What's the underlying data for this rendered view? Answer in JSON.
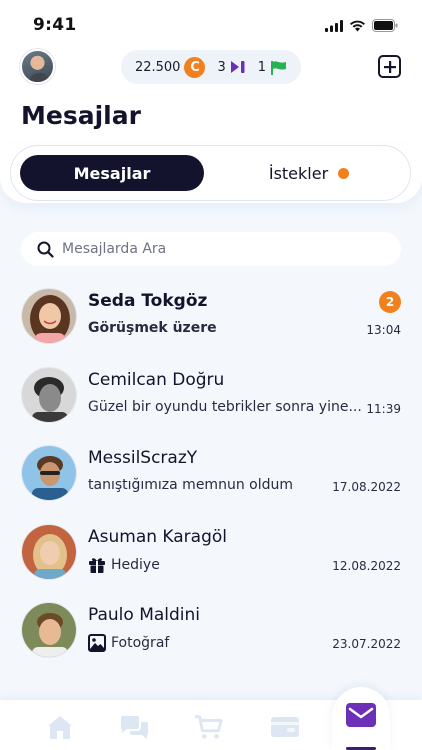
{
  "status_bar": {
    "time": "9:41",
    "icons": [
      "signal-icon",
      "wifi-icon",
      "battery-icon"
    ]
  },
  "header": {
    "coins": "22.500",
    "coin_symbol": "C",
    "games": "3",
    "flags": "1"
  },
  "page_title": "Mesajlar",
  "tabs": [
    {
      "label": "Mesajlar",
      "active": true
    },
    {
      "label": "İstekler",
      "active": false,
      "has_dot": true
    }
  ],
  "search": {
    "placeholder": "Mesajlarda Ara"
  },
  "conversations": [
    {
      "name": "Seda Tokgöz",
      "message": "Görüşmek üzere",
      "time": "13:04",
      "unread": "2",
      "bold": true
    },
    {
      "name": "Cemilcan Doğru",
      "message": "Güzel bir oyundu tebrikler sonra yine...",
      "time": "11:39"
    },
    {
      "name": "MessilScrazY",
      "message": "tanıştığımıza memnun oldum",
      "time": "17.08.2022"
    },
    {
      "name": "Asuman Karagöl",
      "message": "Hediye",
      "time": "12.08.2022",
      "icon": "gift-icon"
    },
    {
      "name": "Paulo Maldini",
      "message": "Fotoğraf",
      "time": "23.07.2022",
      "icon": "image-icon"
    }
  ],
  "bottom_nav": [
    "home-icon",
    "chat-icon",
    "cart-icon",
    "wallet-icon",
    "mail-icon"
  ],
  "colors": {
    "accent": "#f2801c",
    "dark": "#13132d",
    "purple": "#6b2fb8",
    "green": "#27b150",
    "background": "#f4f8fd"
  }
}
